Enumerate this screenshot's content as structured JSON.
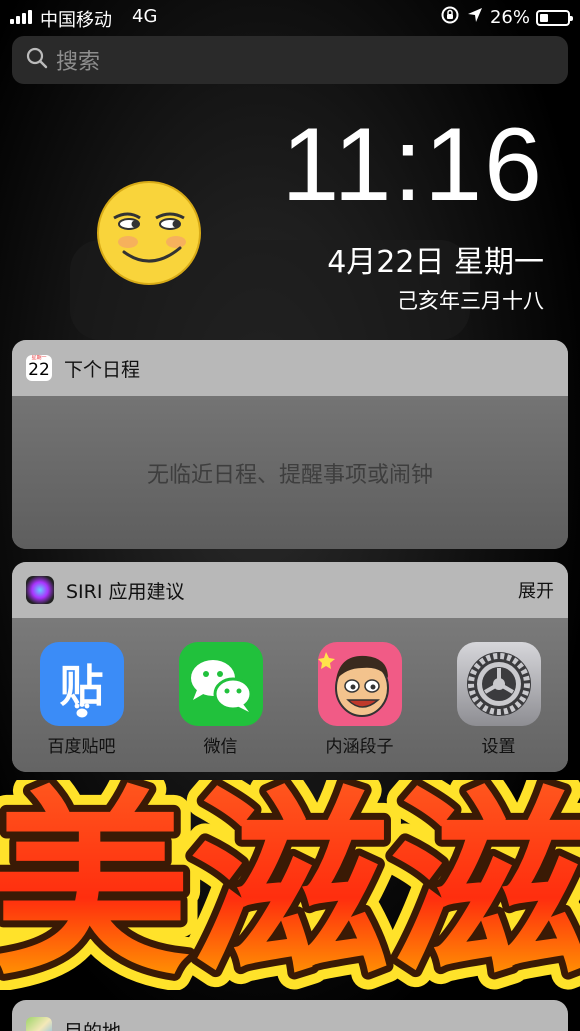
{
  "status": {
    "carrier": "中国移动",
    "network": "4G",
    "battery": "26%",
    "battery_level": 0.26
  },
  "search": {
    "placeholder": "搜索"
  },
  "lockscreen": {
    "time": "11:16",
    "date": "4月22日 星期一",
    "lunar": "己亥年三月十八"
  },
  "calendar_widget": {
    "title": "下个日程",
    "icon_day": "22",
    "icon_header": "星期一",
    "empty_text": "无临近日程、提醒事项或闹钟"
  },
  "siri_widget": {
    "title": "SIRI 应用建议",
    "action": "展开",
    "apps": [
      {
        "name": "百度贴吧",
        "icon": "tieba-icon",
        "glyph": "贴",
        "color": "#3388ff"
      },
      {
        "name": "微信",
        "icon": "wechat-icon",
        "color": "#1fc33a"
      },
      {
        "name": "内涵段子",
        "icon": "neihan-icon",
        "color": "#f2557e"
      },
      {
        "name": "设置",
        "icon": "settings-icon",
        "color": "#8e8e93"
      }
    ]
  },
  "banner": {
    "text": "美滋滋"
  },
  "maps_widget": {
    "title": "目的地"
  }
}
